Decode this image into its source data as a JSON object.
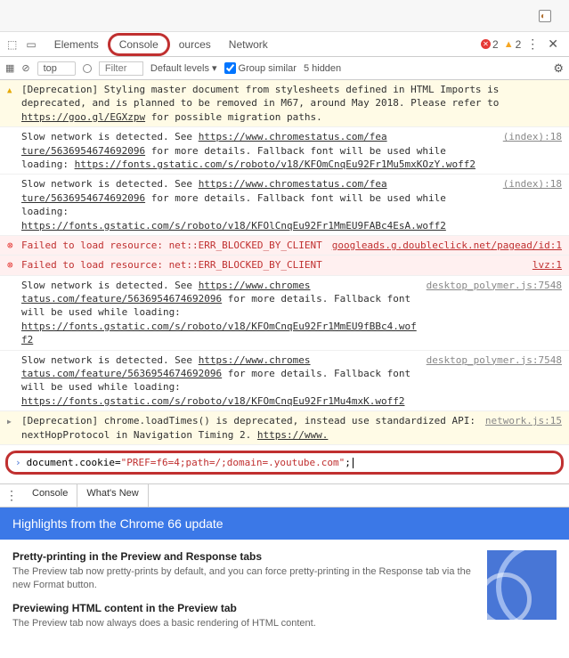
{
  "tabs": {
    "elements": "Elements",
    "console": "Console",
    "sources": "ources",
    "network": "Network"
  },
  "badges": {
    "errors": "2",
    "warnings": "2"
  },
  "filter": {
    "scope": "top",
    "filter_ph": "Filter",
    "levels": "Default levels ▾",
    "group": "Group similar",
    "hidden": "5 hidden"
  },
  "msgs": [
    {
      "type": "warn",
      "text": "[Deprecation] Styling master document from stylesheets defined in HTML Imports is deprecated, and is planned to be removed in M67, around May 2018. Please refer to ",
      "link": "https://goo.gl/EGXzpw",
      "tail": " for possible migration paths."
    },
    {
      "type": "info",
      "text": "Slow network is detected. See ",
      "link": "https://www.chromestatus.com/fea",
      "src": "(index):18",
      "line2": "ture/5636954674692096",
      "tail2": " for more details. Fallback font will be used while loading: ",
      "link2": "https://fonts.gstatic.com/s/roboto/v18/KFOmCnqEu92Fr1Mu5mxKOzY.woff2"
    },
    {
      "type": "info",
      "text": "Slow network is detected. See ",
      "link": "https://www.chromestatus.com/fea",
      "src": "(index):18",
      "line2": "ture/5636954674692096",
      "tail2": " for more details. Fallback font will be used while loading: ",
      "link2": "https://fonts.gstatic.com/s/roboto/v18/KFOlCnqEu92Fr1MmEU9FABc4EsA.woff2"
    },
    {
      "type": "err",
      "text": "Failed to load resource: net::ERR_BLOCKED_BY_CLIENT",
      "src": "googleads.g.doubleclick.net/pagead/id:1"
    },
    {
      "type": "err",
      "text": "Failed to load resource: net::ERR_BLOCKED_BY_CLIENT",
      "src": "lvz:1"
    },
    {
      "type": "info",
      "text": "Slow network is detected. See ",
      "link": "https://www.chromes",
      "src": "desktop_polymer.js:7548",
      "line2": "tatus.com/feature/5636954674692096",
      "tail2": " for more details. Fallback font will be used while loading: ",
      "link2": "https://fonts.gstatic.com/s/roboto/v18/KFOmCnqEu92Fr1MmEU9fBBc4.woff2"
    },
    {
      "type": "info",
      "text": "Slow network is detected. See ",
      "link": "https://www.chromes",
      "src": "desktop_polymer.js:7548",
      "line2": "tatus.com/feature/5636954674692096",
      "tail2": " for more details. Fallback font will be used while loading: ",
      "link2": "https://fonts.gstatic.com/s/roboto/v18/KFOmCnqEu92Fr1Mu4mxK.woff2"
    },
    {
      "type": "warn",
      "caret": true,
      "text": "[Deprecation] chrome.loadTimes() is deprecated, instead use standardized API: nextHopProtocol in Navigation Timing 2. ",
      "link": "https://www.",
      "src": "network.js:15"
    }
  ],
  "prompt": {
    "pre": "document.cookie=",
    "str": "\"PREF=f6=4;path=/;domain=.youtube.com\"",
    "post": ";"
  },
  "drawer": {
    "tab1": "Console",
    "tab2": "What's New"
  },
  "highlights": "Highlights from the Chrome 66 update",
  "wn": {
    "h1": "Pretty-printing in the Preview and Response tabs",
    "p1": "The Preview tab now pretty-prints by default, and you can force pretty-printing in the Response tab via the new Format button.",
    "h2": "Previewing HTML content in the Preview tab",
    "p2": "The Preview tab now always does a basic rendering of HTML content."
  }
}
